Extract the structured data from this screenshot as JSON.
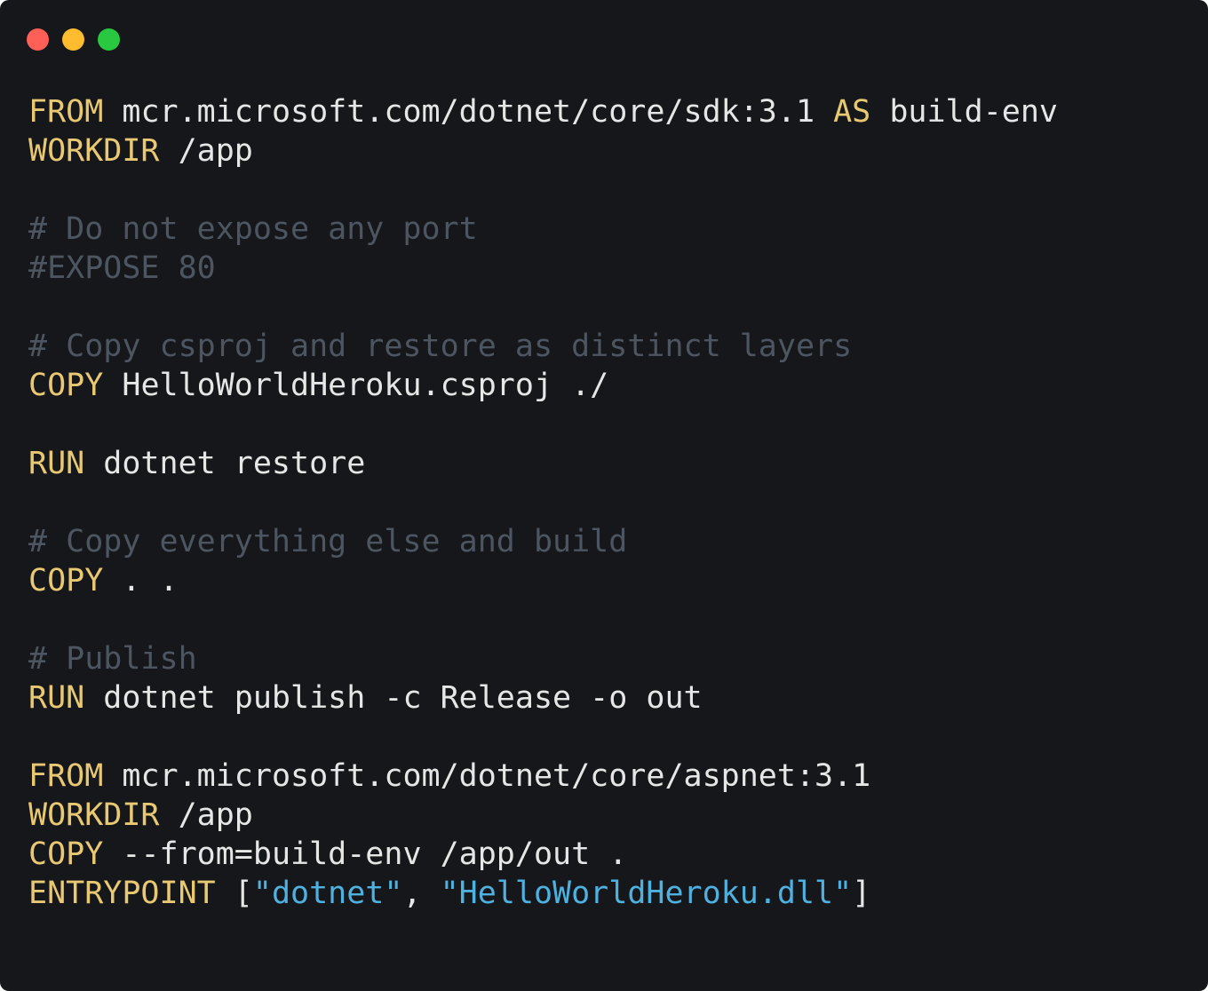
{
  "window": {
    "buttons": [
      {
        "name": "close",
        "color": "#fe5f57"
      },
      {
        "name": "minimize",
        "color": "#febc2e"
      },
      {
        "name": "maximize",
        "color": "#28c840"
      }
    ]
  },
  "colors": {
    "background": "#16171a",
    "keyword": "#e8c872",
    "comment": "#4c5560",
    "string": "#4fb1e0",
    "text": "#e6e6e6"
  },
  "code": {
    "lines": [
      [
        {
          "t": "kw",
          "v": "FROM"
        },
        {
          "t": "tx",
          "v": " mcr.microsoft.com/dotnet/core/sdk:3.1 "
        },
        {
          "t": "kw",
          "v": "AS"
        },
        {
          "t": "tx",
          "v": " build-env"
        }
      ],
      [
        {
          "t": "kw",
          "v": "WORKDIR"
        },
        {
          "t": "tx",
          "v": " /app"
        }
      ],
      [],
      [
        {
          "t": "cm",
          "v": "# Do not expose any port"
        }
      ],
      [
        {
          "t": "cm",
          "v": "#EXPOSE 80"
        }
      ],
      [],
      [
        {
          "t": "cm",
          "v": "# Copy csproj and restore as distinct layers"
        }
      ],
      [
        {
          "t": "kw",
          "v": "COPY"
        },
        {
          "t": "tx",
          "v": " HelloWorldHeroku.csproj ./"
        }
      ],
      [],
      [
        {
          "t": "kw",
          "v": "RUN"
        },
        {
          "t": "tx",
          "v": " dotnet restore"
        }
      ],
      [],
      [
        {
          "t": "cm",
          "v": "# Copy everything else and build"
        }
      ],
      [
        {
          "t": "kw",
          "v": "COPY"
        },
        {
          "t": "tx",
          "v": " . ."
        }
      ],
      [],
      [
        {
          "t": "cm",
          "v": "# Publish"
        }
      ],
      [
        {
          "t": "kw",
          "v": "RUN"
        },
        {
          "t": "tx",
          "v": " dotnet publish -c Release -o out"
        }
      ],
      [],
      [
        {
          "t": "kw",
          "v": "FROM"
        },
        {
          "t": "tx",
          "v": " mcr.microsoft.com/dotnet/core/aspnet:3.1"
        }
      ],
      [
        {
          "t": "kw",
          "v": "WORKDIR"
        },
        {
          "t": "tx",
          "v": " /app"
        }
      ],
      [
        {
          "t": "kw",
          "v": "COPY"
        },
        {
          "t": "tx",
          "v": " --from=build-env /app/out ."
        }
      ],
      [
        {
          "t": "kw",
          "v": "ENTRYPOINT"
        },
        {
          "t": "tx",
          "v": " ["
        },
        {
          "t": "st",
          "v": "\"dotnet\""
        },
        {
          "t": "tx",
          "v": ", "
        },
        {
          "t": "st",
          "v": "\"HelloWorldHeroku.dll\""
        },
        {
          "t": "tx",
          "v": "]"
        }
      ]
    ]
  }
}
